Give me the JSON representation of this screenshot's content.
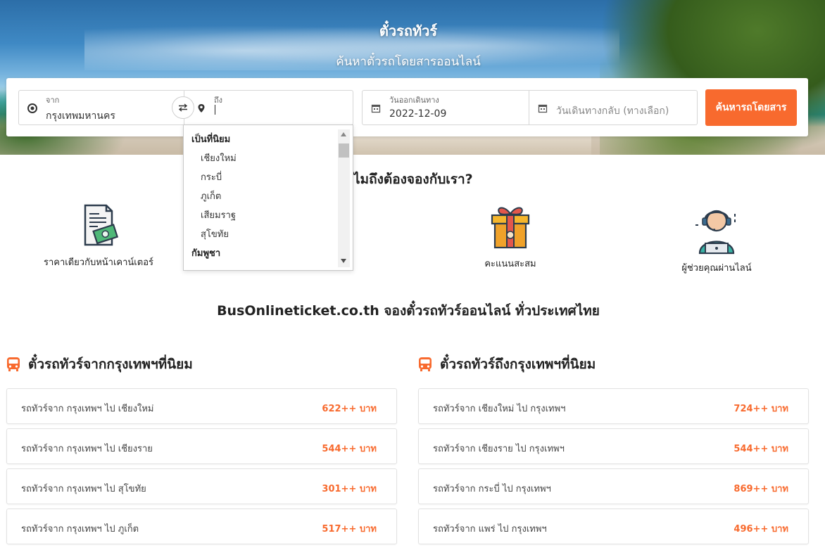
{
  "hero": {
    "title": "ตั๋วรถทัวร์",
    "subtitle": "ค้นหาตั๋วรถโดยสารออนไลน์"
  },
  "search": {
    "from": {
      "label": "จาก",
      "value": "กรุงเทพมหานคร"
    },
    "to": {
      "label": "ถึง",
      "value": ""
    },
    "depart": {
      "label": "วันออกเดินทาง",
      "value": "2022-12-09"
    },
    "return": {
      "placeholder": "วันเดินทางกลับ (ทางเลือก)"
    },
    "button_label": "ค้นหารถโดยสาร"
  },
  "dropdown": {
    "groups": [
      {
        "label": "เป็นที่นิยม",
        "items": [
          "เชียงใหม่",
          "กระบี่",
          "ภูเก็ต",
          "เสียมราฐ",
          "สุโขทัย"
        ]
      },
      {
        "label": "กัมพูชา",
        "items": []
      }
    ]
  },
  "why": {
    "title": "ไมถึงต้องจองกับเรา?",
    "features": [
      {
        "label": "ราคาเดียวกับหน้าเคาน์เตอร์",
        "icon": "ticket-money-icon"
      },
      {
        "label": "คะแนนสะสม",
        "icon": "gift-box-icon"
      },
      {
        "label": "ผู้ช่วยคุณผ่านไลน์",
        "icon": "support-agent-icon"
      }
    ]
  },
  "tagline": "BusOnlineticket.co.th จองตั๋วรถทัวร์ออนไลน์ ทั่วประเทศไทย",
  "popular_from": {
    "title": "ตั๋วรถทัวร์จากกรุงเทพฯที่นิยม",
    "routes": [
      {
        "name": "รถทัวร์จาก กรุงเทพฯ ไป เชียงใหม่",
        "price": "622++ บาท"
      },
      {
        "name": "รถทัวร์จาก กรุงเทพฯ ไป เชียงราย",
        "price": "544++ บาท"
      },
      {
        "name": "รถทัวร์จาก กรุงเทพฯ ไป สุโขทัย",
        "price": "301++ บาท"
      },
      {
        "name": "รถทัวร์จาก กรุงเทพฯ ไป ภูเก็ต",
        "price": "517++ บาท"
      }
    ]
  },
  "popular_to": {
    "title": "ตั๋วรถทัวร์ถึงกรุงเทพฯที่นิยม",
    "routes": [
      {
        "name": "รถทัวร์จาก เชียงใหม่ ไป กรุงเทพฯ",
        "price": "724++ บาท"
      },
      {
        "name": "รถทัวร์จาก เชียงราย ไป กรุงเทพฯ",
        "price": "544++ บาท"
      },
      {
        "name": "รถทัวร์จาก กระบี่ ไป กรุงเทพฯ",
        "price": "869++ บาท"
      },
      {
        "name": "รถทัวร์จาก แพร่ ไป กรุงเทพฯ",
        "price": "496++ บาท"
      }
    ]
  },
  "colors": {
    "accent": "#f86a2e",
    "text": "#222222"
  }
}
